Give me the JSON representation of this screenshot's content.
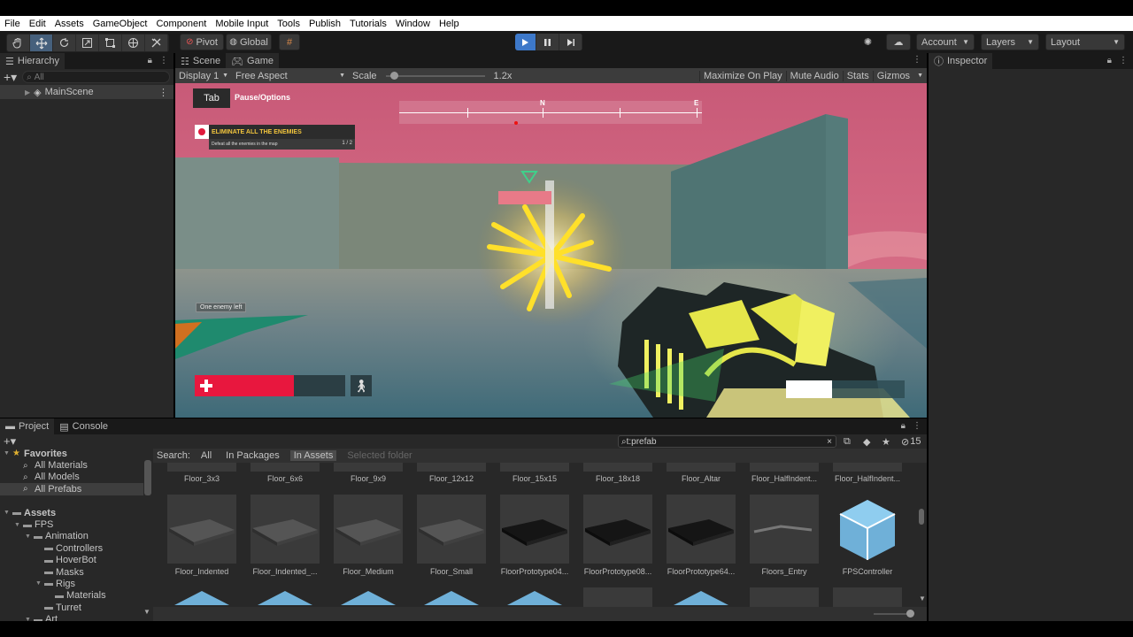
{
  "menu": [
    "File",
    "Edit",
    "Assets",
    "GameObject",
    "Component",
    "Mobile Input",
    "Tools",
    "Publish",
    "Tutorials",
    "Window",
    "Help"
  ],
  "toolbar": {
    "pivot": "Pivot",
    "global": "Global",
    "account": "Account",
    "layers": "Layers",
    "layout": "Layout"
  },
  "hierarchy": {
    "tab": "Hierarchy",
    "search_placeholder": "All",
    "scene": "MainScene"
  },
  "scene_tabs": {
    "scene": "Scene",
    "game": "Game"
  },
  "gamebar": {
    "display": "Display 1",
    "aspect": "Free Aspect",
    "scale_label": "Scale",
    "scale_value": "1.2x",
    "scale_level": 0.05,
    "maximize": "Maximize On Play",
    "mute": "Mute Audio",
    "stats": "Stats",
    "gizmos": "Gizmos"
  },
  "game_hud": {
    "tab_key": "Tab",
    "pause": "Pause/Options",
    "compass_n": "N",
    "compass_e": "E",
    "objective_title": "ELIMINATE ALL THE ENEMIES",
    "objective_desc": "Defeat all the enemies in the map",
    "objective_count": "1 / 2",
    "enemy_left": "One enemy left",
    "health_level": 0.66
  },
  "inspector": {
    "tab": "Inspector"
  },
  "project": {
    "tab": "Project",
    "console_tab": "Console",
    "search_value": "t:prefab",
    "search_label": "Search:",
    "filters": [
      "All",
      "In Packages",
      "In Assets",
      "Selected folder"
    ],
    "hidden_count": "15",
    "tree": [
      {
        "label": "Favorites",
        "indent": 0,
        "icon": "star"
      },
      {
        "label": "All Materials",
        "indent": 1,
        "icon": "search"
      },
      {
        "label": "All Models",
        "indent": 1,
        "icon": "search"
      },
      {
        "label": "All Prefabs",
        "indent": 1,
        "icon": "search"
      },
      {
        "label": "",
        "indent": 0,
        "icon": ""
      },
      {
        "label": "Assets",
        "indent": 0,
        "icon": "folder"
      },
      {
        "label": "FPS",
        "indent": 1,
        "icon": "folder"
      },
      {
        "label": "Animation",
        "indent": 2,
        "icon": "folder"
      },
      {
        "label": "Controllers",
        "indent": 3,
        "icon": "folder"
      },
      {
        "label": "HoverBot",
        "indent": 3,
        "icon": "folder"
      },
      {
        "label": "Masks",
        "indent": 3,
        "icon": "folder"
      },
      {
        "label": "Rigs",
        "indent": 3,
        "icon": "folder"
      },
      {
        "label": "Materials",
        "indent": 4,
        "icon": "folder"
      },
      {
        "label": "Turret",
        "indent": 3,
        "icon": "folder"
      },
      {
        "label": "Art",
        "indent": 2,
        "icon": "folder"
      }
    ],
    "row1": [
      "Floor_3x3",
      "Floor_6x6",
      "Floor_9x9",
      "Floor_12x12",
      "Floor_15x15",
      "Floor_18x18",
      "Floor_Altar",
      "Floor_HalfIndent...",
      "Floor_HalfIndent..."
    ],
    "row2": [
      "Floor_Indented",
      "Floor_Indented_...",
      "Floor_Medium",
      "Floor_Small",
      "FloorPrototype04...",
      "FloorPrototype08...",
      "FloorPrototype64...",
      "Floors_Entry",
      "FPSController"
    ]
  },
  "colors": {
    "accent": "#46607c",
    "play": "#3d78c9",
    "health": "#e8173e",
    "sky": "#d4607a"
  }
}
